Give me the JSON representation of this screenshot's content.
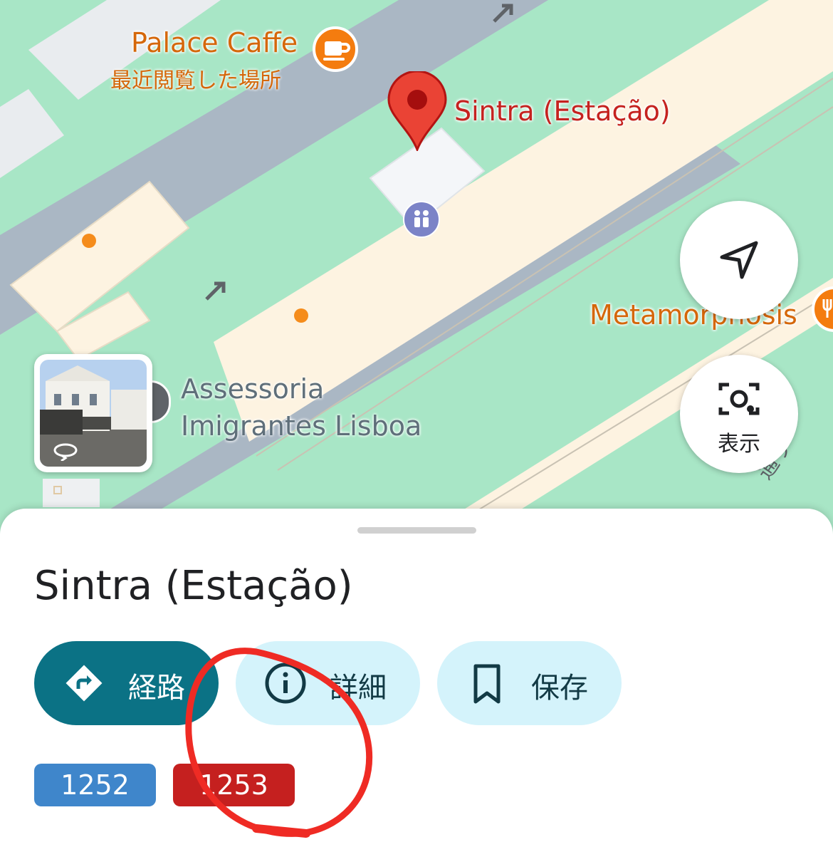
{
  "map": {
    "pin_label": "Sintra (Estação)",
    "caffe": {
      "name": "Palace Caffe",
      "subtitle": "最近閲覧した場所",
      "icon": "coffee-icon"
    },
    "metamorphosis_label": "Metamorphosis",
    "assessoria_label": [
      "Assessoria",
      "Imigrantes Lisboa"
    ],
    "street_label": "通り",
    "lens_label": "表示",
    "colors": {
      "park": "#9fe0bd",
      "road": "#aab7c4",
      "rail": "#fdf3e1",
      "accent": "#d5670a"
    }
  },
  "sheet": {
    "title": "Sintra (Estação)",
    "buttons": {
      "route": "経路",
      "details": "詳細",
      "save": "保存"
    },
    "badges": [
      "1252",
      "1253"
    ],
    "colors": {
      "route_bg": "#0b7285",
      "chip_bg": "#d4f3fb",
      "badge_blue": "#3f86cb",
      "badge_red": "#c5201f"
    }
  }
}
